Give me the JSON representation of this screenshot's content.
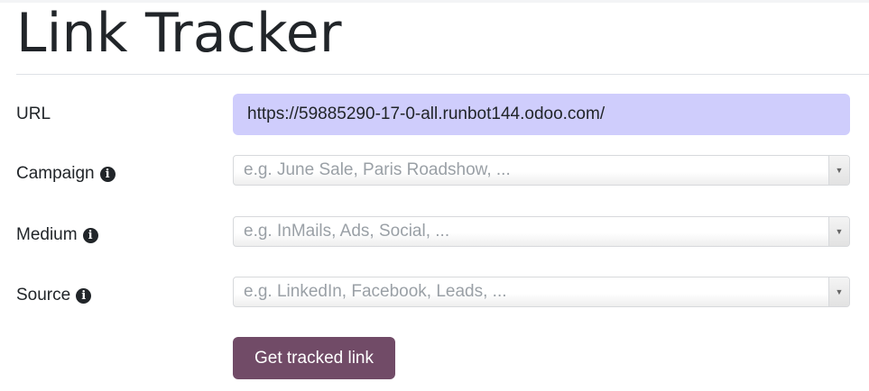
{
  "page": {
    "title": "Link Tracker"
  },
  "form": {
    "url": {
      "label": "URL",
      "value": "https://59885290-17-0-all.runbot144.odoo.com/"
    },
    "campaign": {
      "label": "Campaign",
      "placeholder": "e.g. June Sale, Paris Roadshow, ...",
      "icon": "info-circle-icon"
    },
    "medium": {
      "label": "Medium",
      "placeholder": "e.g. InMails, Ads, Social, ...",
      "icon": "info-circle-icon"
    },
    "source": {
      "label": "Source",
      "placeholder": "e.g. LinkedIn, Facebook, Leads, ...",
      "icon": "info-circle-icon"
    },
    "submit_label": "Get tracked link"
  },
  "colors": {
    "url_field_bg": "#cfcdfc",
    "button_bg": "#714b67",
    "placeholder": "#9aa0a6"
  }
}
